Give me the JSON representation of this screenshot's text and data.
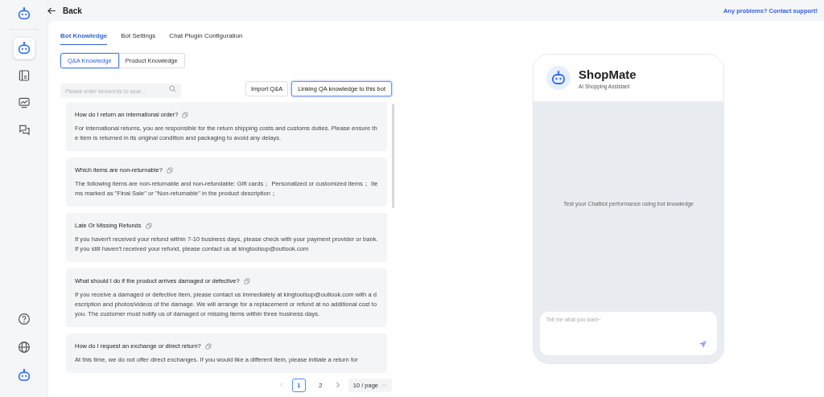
{
  "header": {
    "back": "Back",
    "support_link": "Any problems? Contact support!"
  },
  "sidebar": {
    "items": [
      {
        "kind": "bot",
        "selected": true
      },
      {
        "kind": "book",
        "selected": false
      },
      {
        "kind": "chart",
        "selected": false
      },
      {
        "kind": "chat",
        "selected": false
      }
    ],
    "bottom": [
      {
        "kind": "help"
      },
      {
        "kind": "globe"
      },
      {
        "kind": "bot"
      }
    ]
  },
  "tabs": [
    {
      "label": "Bot Knowledge",
      "selected": true
    },
    {
      "label": "Bot Settings",
      "selected": false
    },
    {
      "label": "Chat Plugin Configuration",
      "selected": false
    }
  ],
  "subtabs": [
    {
      "label": "Q&A Knowledge",
      "selected": true
    },
    {
      "label": "Product Knowledge",
      "selected": false
    }
  ],
  "search": {
    "placeholder": "Please enter keywords to sear..."
  },
  "buttons": [
    {
      "label": "Import Q&A",
      "kind": "default"
    },
    {
      "label": "Linking QA knowledge to this bot",
      "kind": "focused"
    }
  ],
  "qa_items": [
    {
      "question": "How do I return an international order?",
      "answer": "For international returns, you are responsible for the return shipping costs and customs duties. Please ensure the item is returned in its original condition and packaging to avoid any delays."
    },
    {
      "question": "Which items are non-returnable?",
      "answer": "The following items are non-returnable and non-refundable: Gift cards；  Personalized or customized items；  Items marked as \"Final Sale\" or \"Non-returnable\" in the product description；"
    },
    {
      "question": "Late Or Missing Refunds",
      "answer": "If you haven't received your refund within 7-10 business days, please check with your payment provider or bank. If you still haven't received your refund, please contact us at kingtoolsup@outlook.com"
    },
    {
      "question": "What should I do if the product arrives damaged or defective?",
      "answer": "If you receive a damaged or defective item, please contact us immediately at kingtoolsup@outlook.com with a description and photos/videos of the damage. We will arrange for a replacement or refund at no additional cost to you. The customer must notify us of damaged or missing items within three business days."
    },
    {
      "question": "How do I request an exchange or direct return?",
      "answer": "At this time, we do not offer direct exchanges. If you would like a different item, please initiate a return for"
    }
  ],
  "pagination": {
    "pages": [
      {
        "label": "1",
        "selected": true
      },
      {
        "label": "2",
        "selected": false
      }
    ],
    "page_size": "10 / page"
  },
  "preview": {
    "bot_name": "ShopMate",
    "subtitle": "AI Shopping Assistant",
    "hint": "Test your Chatbot performance using bot knowledge",
    "input": {
      "placeholder": "Tell me what you want~"
    }
  }
}
